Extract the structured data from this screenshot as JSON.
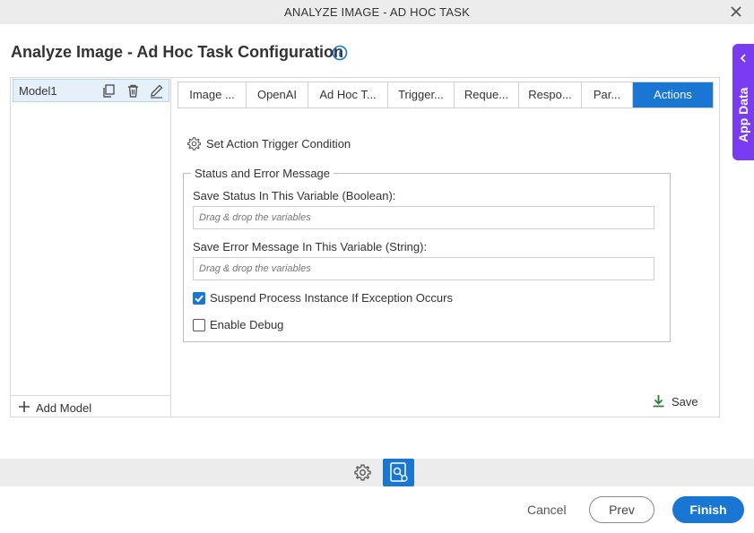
{
  "window": {
    "title": "ANALYZE IMAGE - AD HOC TASK"
  },
  "page": {
    "title": "Analyze Image - Ad Hoc Task Configuration"
  },
  "side_panel": {
    "label": "App Data",
    "color": "#7a3cf0"
  },
  "models": {
    "items": [
      {
        "name": "Model1"
      }
    ],
    "add_label": "Add Model"
  },
  "tabs": [
    {
      "label": "Image ..."
    },
    {
      "label": "OpenAI"
    },
    {
      "label": "Ad Hoc T..."
    },
    {
      "label": "Trigger..."
    },
    {
      "label": "Reque..."
    },
    {
      "label": "Respo..."
    },
    {
      "label": "Par..."
    },
    {
      "label": "Actions",
      "active": true
    }
  ],
  "actions": {
    "trigger_label": "Set Action Trigger Condition",
    "group_title": "Status and Error Message",
    "status_label": "Save Status In This Variable (Boolean):",
    "status_placeholder": "Drag & drop the variables",
    "error_label": "Save Error Message In This Variable (String):",
    "error_placeholder": "Drag & drop the variables",
    "suspend_label": "Suspend Process Instance If Exception Occurs",
    "suspend_checked": true,
    "debug_label": "Enable Debug",
    "debug_checked": false,
    "save_label": "Save"
  },
  "footer": {
    "cancel": "Cancel",
    "prev": "Prev",
    "finish": "Finish"
  },
  "colors": {
    "accent": "#1976d2",
    "save_icon": "#2e7d32"
  }
}
